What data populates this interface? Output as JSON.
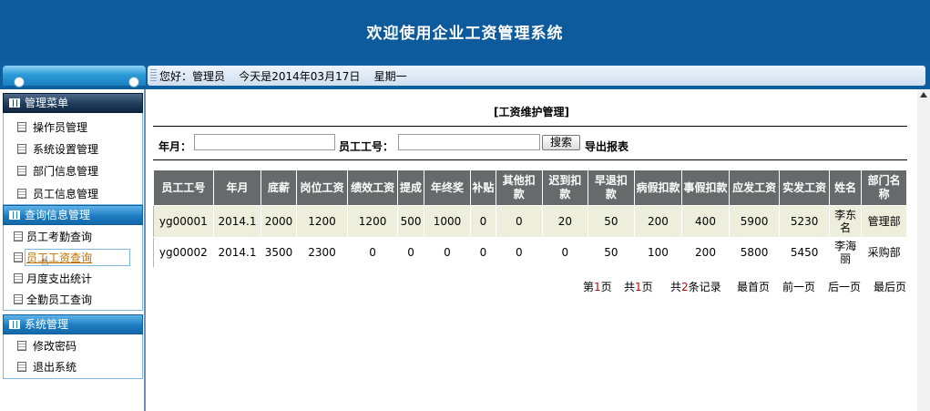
{
  "banner": {
    "title": "欢迎使用企业工资管理系统"
  },
  "infobar": {
    "text": "您好：管理员    今天是2014年03月17日    星期一"
  },
  "sidebar": {
    "header": "管理菜单",
    "admin_items": [
      "操作员管理",
      "系统设置管理",
      "部门信息管理",
      "员工信息管理"
    ],
    "query_header": "查询信息管理",
    "query_items": [
      "员工考勤查询",
      "员工工资查询",
      "月度支出统计",
      "全勤员工查询"
    ],
    "system_header": "系统管理",
    "system_items": [
      "修改密码",
      "退出系统"
    ]
  },
  "main": {
    "title": "[工资维护管理]",
    "month_label": "年月：",
    "month_value": "",
    "empno_label": "员工工号：",
    "empno_value": "",
    "search_label": "搜索",
    "export_label": "导出报表"
  },
  "table": {
    "headers": [
      "员工工号",
      "年月",
      "底薪",
      "岗位工资",
      "绩效工资",
      "提成",
      "年终奖",
      "补贴",
      "其他扣款",
      "迟到扣款",
      "早退扣款",
      "病假扣款",
      "事假扣款",
      "应发工资",
      "实发工资",
      "姓名",
      "部门名称"
    ],
    "rows": [
      [
        "yg00001",
        "2014.1",
        "2000",
        "1200",
        "1200",
        "500",
        "1000",
        "0",
        "0",
        "20",
        "50",
        "200",
        "400",
        "5900",
        "5230",
        "李东名",
        "管理部"
      ],
      [
        "yg00002",
        "2014.1",
        "3500",
        "2300",
        "0",
        "0",
        "0",
        "0",
        "0",
        "0",
        "50",
        "100",
        "200",
        "5800",
        "5450",
        "李海丽",
        "采购部"
      ]
    ]
  },
  "pager": {
    "page_prefix": "第",
    "page_num": "1",
    "page_suffix": "页",
    "total_prefix": "共",
    "total_pages": "1",
    "total_suffix": "页",
    "records_prefix": "共",
    "records_num": "2",
    "records_suffix": "条记录",
    "first": "最首页",
    "prev": "前一页",
    "next": "后一页",
    "last": "最后页"
  },
  "colors": {
    "banner": "#0d5b9c",
    "table_header": "#666a6b",
    "row_highlight": "#eeeedc",
    "accent_red": "#cc0000"
  }
}
